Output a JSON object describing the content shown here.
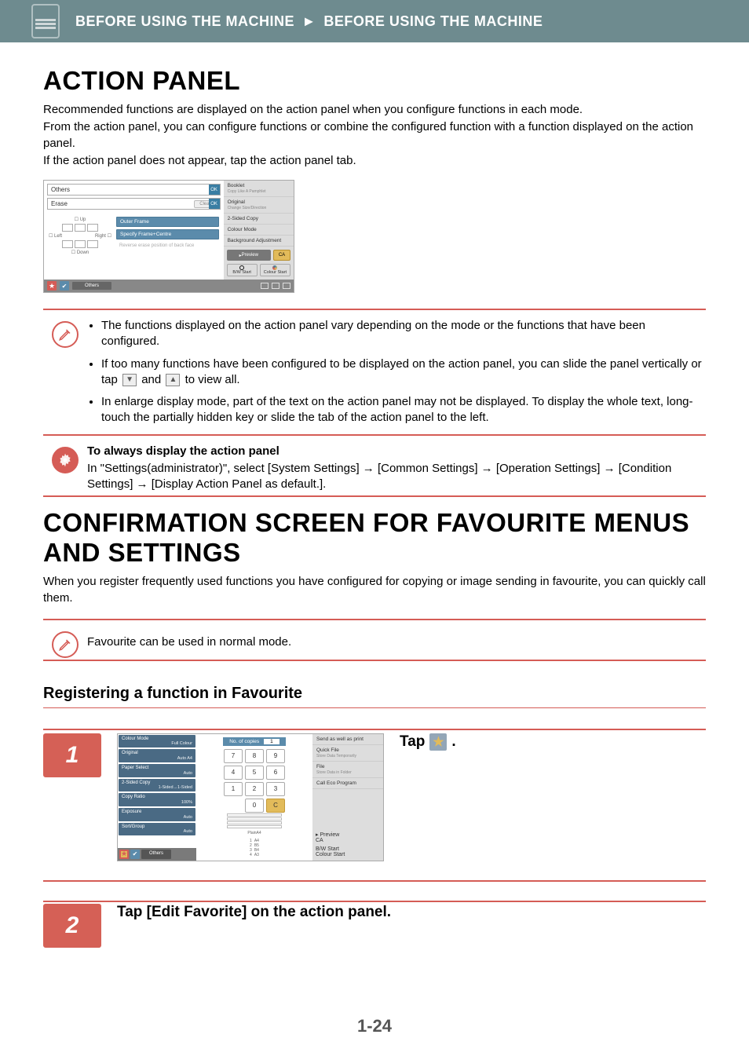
{
  "header": {
    "crumb1": "BEFORE USING THE MACHINE",
    "sep": "►",
    "crumb2": "BEFORE USING THE MACHINE"
  },
  "section1": {
    "title": "ACTION PANEL",
    "p1": "Recommended functions are displayed on the action panel when you configure functions in each mode.",
    "p2": "From the action panel, you can configure functions or combine the configured function with a function displayed on the action panel.",
    "p3": "If the action panel does not appear, tap the action panel tab."
  },
  "mock1": {
    "others": "Others",
    "ok": "OK",
    "erase": "Erase",
    "clear": "Clear",
    "up": "Up",
    "left": "Left",
    "right": "Right",
    "down": "Down",
    "outerFrame": "Outer Frame",
    "specifyFrame": "Specify Frame+Centre",
    "reverseErase": "Reverse erase position of back face",
    "side_booklet": "Booklet",
    "side_booklet_sub": "Copy Like A Pamphlet",
    "side_original": "Original",
    "side_original_sub": "Change Size/Direction",
    "side_2sided": "2-Sided Copy",
    "side_colourMode": "Colour Mode",
    "side_bg": "Background Adjustment",
    "preview": "Preview",
    "ca": "CA",
    "bwStart": "B/W Start",
    "colourStart": "Colour Start",
    "othersBtn": "Others"
  },
  "notes1": {
    "li1": "The functions displayed on the action panel vary depending on the mode or the functions that have been configured.",
    "li2a": "If too many functions have been configured to be displayed on the action panel, you can slide the panel vertically or tap ",
    "li2b": " and ",
    "li2c": " to view all.",
    "li3": "In enlarge display mode, part of the text on the action panel may not be displayed. To display the whole text, long-touch the partially hidden key or slide the tab of the action panel to the left."
  },
  "notes2": {
    "title": "To always display the action panel",
    "body": "In \"Settings(administrator)\", select [System Settings] →  [Common Settings] → [Operation Settings] → [Condition Settings] → [Display Action Panel as default.]."
  },
  "section2": {
    "title": "CONFIRMATION SCREEN FOR FAVOURITE MENUS AND SETTINGS",
    "p1": "When you register frequently used functions you have configured for copying or image sending in favourite, you can quickly call them."
  },
  "notes3": {
    "body": "Favourite can be used in normal mode."
  },
  "section3": {
    "title": "Registering a function in Favourite"
  },
  "step1": {
    "num": "1",
    "tap_label_before": "Tap ",
    "tap_label_after": " ."
  },
  "mock2": {
    "colourMode": "Colour Mode",
    "fullColour": "Full Colour",
    "original": "Original",
    "autoA4": "Auto  A4",
    "paperSelect": "Paper Select",
    "auto": "Auto",
    "twoSided": "2-Sided Copy",
    "twoSidedVal": "1-Sided→1-Sided",
    "copyRatio": "Copy Ratio",
    "pct100": "100%",
    "exposure": "Exposure",
    "sortGroup": "Sort/Group",
    "others": "Others",
    "noCopies": "No. of copies",
    "copiesVal": "1",
    "k7": "7",
    "k8": "8",
    "k9": "9",
    "k4": "4",
    "k5": "5",
    "k6": "6",
    "k1": "1",
    "k2": "2",
    "k3": "3",
    "k0": "0",
    "kc": "C",
    "plain": "Plain",
    "a4": "A4",
    "tray1": "1",
    "tray1v": "A4",
    "tray2": "2",
    "tray2v": "B5",
    "tray3": "3",
    "tray3v": "B4",
    "tray4": "4",
    "tray4v": "A3",
    "send": "Send as well as print",
    "quickFile": "Quick File",
    "quickFileSub": "Store Data Temporarily",
    "file": "File",
    "fileSub": "Store Data in Folder",
    "eco": "Call Eco Program",
    "preview": "Preview",
    "ca": "CA",
    "bwStart": "B/W Start",
    "colourStart": "Colour Start"
  },
  "step2": {
    "num": "2",
    "text": "Tap [Edit Favorite] on the action panel."
  },
  "pageNumber": "1-24"
}
